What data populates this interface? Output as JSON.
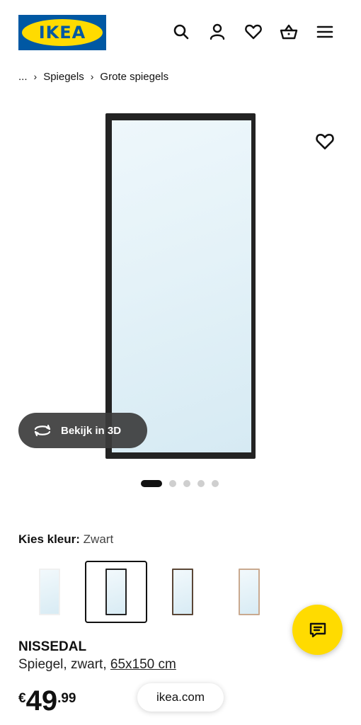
{
  "header": {
    "logo_text": "IKEA",
    "icons": [
      "search-icon",
      "user-icon",
      "heart-icon",
      "basket-icon",
      "menu-icon"
    ]
  },
  "breadcrumb": {
    "ellipsis": "...",
    "items": [
      "Spiegels",
      "Grote spiegels"
    ]
  },
  "gallery": {
    "view_3d_label": "Bekijk in 3D",
    "slide_count": 5,
    "active_slide": 1
  },
  "color": {
    "label": "Kies kleur:",
    "value": "Zwart",
    "swatches": [
      {
        "frame_color": "#f0f0f0",
        "selected": false
      },
      {
        "frame_color": "#222222",
        "selected": true
      },
      {
        "frame_color": "#5a4636",
        "selected": false
      },
      {
        "frame_color": "#c9a98f",
        "selected": false
      }
    ]
  },
  "product": {
    "name": "NISSEDAL",
    "description": "Spiegel, zwart,",
    "dimensions": "65x150 cm"
  },
  "price": {
    "currency": "€",
    "integer": "49",
    "decimals": ".99"
  },
  "browser": {
    "url": "ikea.com"
  },
  "colors": {
    "ikea_blue": "#0058a3",
    "ikea_yellow": "#ffdb00"
  }
}
